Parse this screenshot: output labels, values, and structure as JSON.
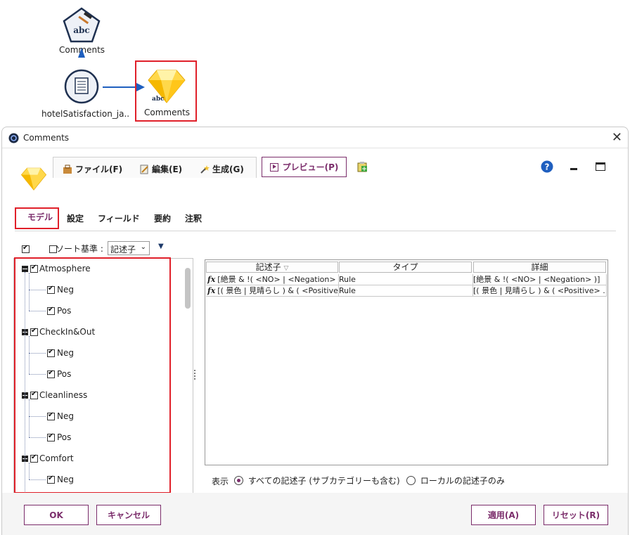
{
  "canvas": {
    "node_top_label": "Comments",
    "node_source_label": "hotelSatisfaction_ja..",
    "node_model_label": "Comments"
  },
  "dialog": {
    "title": "Comments",
    "menu": {
      "file": "ファイル(F)",
      "edit": "編集(E)",
      "generate": "生成(G)"
    },
    "preview_label": "プレビュー(P)",
    "tabs": [
      "モデル",
      "設定",
      "フィールド",
      "要約",
      "注釈"
    ],
    "sort_label": "ソート基準 :",
    "sort_value": "記述子",
    "tree": [
      {
        "label": "Atmosphere",
        "children": [
          "Neg",
          "Pos"
        ]
      },
      {
        "label": "CheckIn&Out",
        "children": [
          "Neg",
          "Pos"
        ]
      },
      {
        "label": "Cleanliness",
        "children": [
          "Neg",
          "Pos"
        ]
      },
      {
        "label": "Comfort",
        "children": [
          "Neg"
        ]
      }
    ],
    "grid": {
      "headers": [
        "記述子",
        "タイプ",
        "詳細"
      ],
      "rows": [
        [
          "[絶景 & !( <NO> |  <Negation> )]",
          "Rule",
          "[絶景 & !( <NO> |  <Negation> )]"
        ],
        [
          "[( 景色 | 見晴らし ) & ( <Positive>",
          "Rule",
          "[( 景色 | 見晴らし ) & ( <Positive> ..."
        ]
      ]
    },
    "display_label": "表示",
    "radio_all": "すべての記述子 (サブカテゴリーも含む)",
    "radio_local": "ローカルの記述子のみ",
    "buttons": {
      "ok": "OK",
      "cancel": "キャンセル",
      "apply": "適用(A)",
      "reset": "リセット(R)"
    }
  },
  "colors": {
    "accent": "#7b2d6b",
    "highlight": "#e0202a",
    "link_arrow": "#1f5fbf"
  }
}
